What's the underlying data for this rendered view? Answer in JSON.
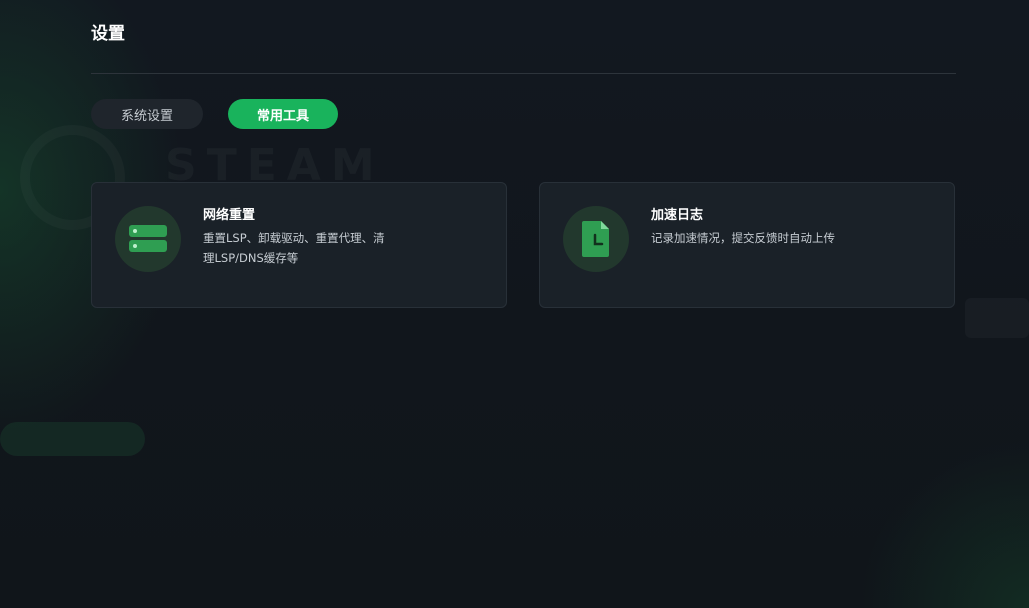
{
  "header": {
    "title": "设置"
  },
  "tabs": [
    {
      "label": "系统设置",
      "active": false
    },
    {
      "label": "常用工具",
      "active": true
    }
  ],
  "cards": [
    {
      "title": "网络重置",
      "description": "重置LSP、卸载驱动、重置代理、清理LSP/DNS缓存等",
      "icon": "server-stack-icon"
    },
    {
      "title": "加速日志",
      "description": "记录加速情况，提交反馈时自动上传",
      "icon": "document-clock-icon"
    }
  ],
  "colors": {
    "accent": "#19b35c",
    "card_bg": "#1a2128",
    "page_bg": "#11161c"
  }
}
